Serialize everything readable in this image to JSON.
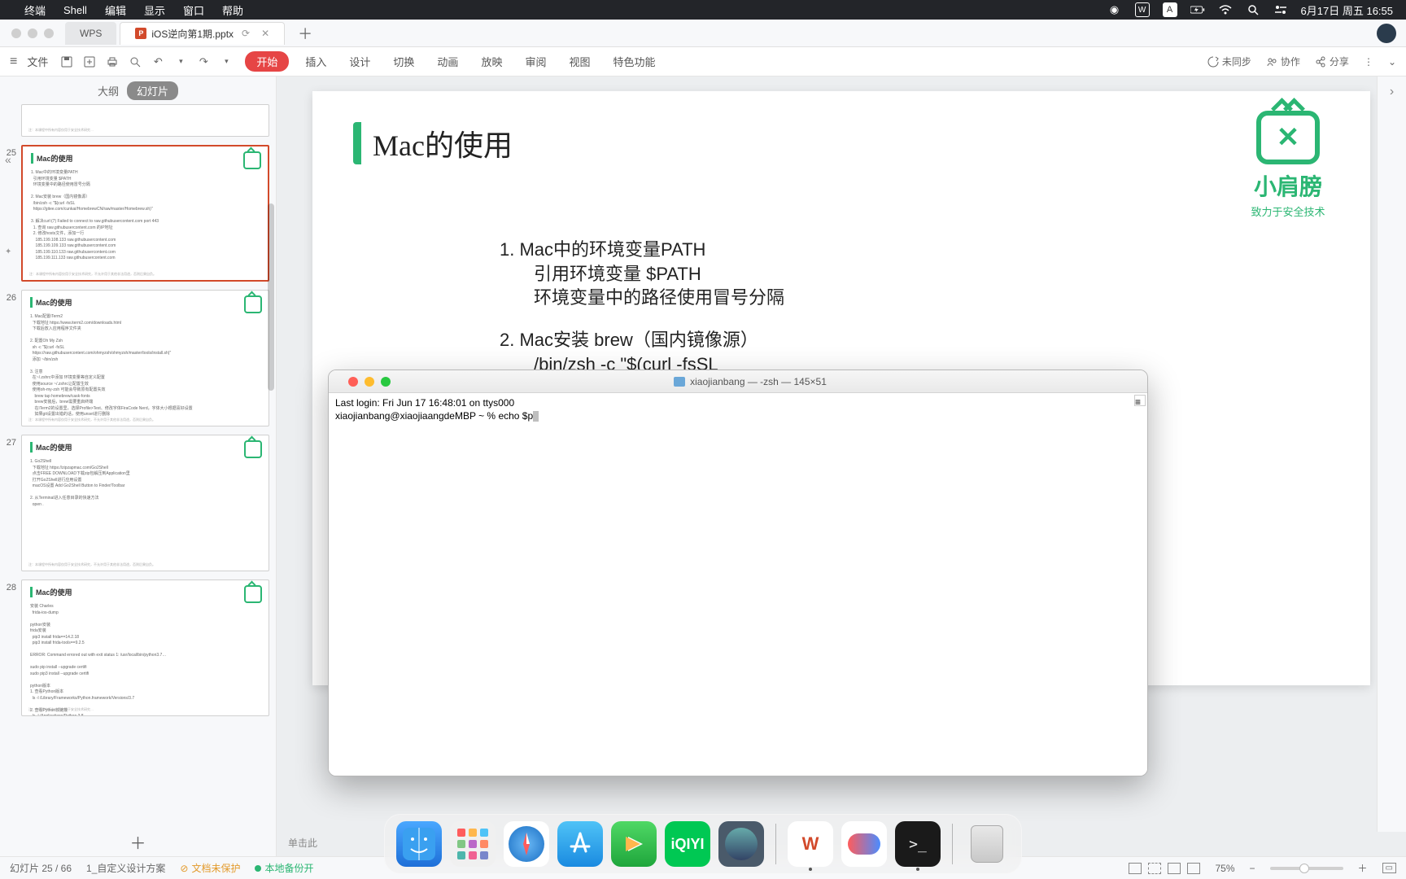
{
  "menubar": {
    "app": "终端",
    "items": [
      "Shell",
      "编辑",
      "显示",
      "窗口",
      "帮助"
    ],
    "date": "6月17日 周五 16:55"
  },
  "wps": {
    "home_tab": "WPS",
    "file_tab": "iOS逆向第1期.pptx",
    "ribbon": {
      "file": "文件",
      "start": "开始",
      "tabs": [
        "插入",
        "设计",
        "切换",
        "动画",
        "放映",
        "审阅",
        "视图",
        "特色功能"
      ],
      "unsync": "未同步",
      "collab": "协作",
      "share": "分享"
    },
    "left": {
      "outline": "大纲",
      "slides": "幻灯片",
      "thumb_title": "Mac的使用",
      "numbers": [
        "25",
        "26",
        "27",
        "28"
      ]
    },
    "slide": {
      "title": "Mac的使用",
      "l1": "1. Mac中的环境变量PATH",
      "l1a": "引用环境变量 $PATH",
      "l1b": "环境变量中的路径使用冒号分隔",
      "l2": "2. Mac安装 brew（国内镜像源）",
      "l2a": "/bin/zsh -c \"$(curl -fsSL",
      "right_snip": "地址",
      "foot": "注",
      "brand": "小肩膀",
      "tagline": "致力于安全技术"
    },
    "canvas_hint": "单击此",
    "status": {
      "page": "幻灯片 25 / 66",
      "scheme": "1_自定义设计方案",
      "protect": "文档未保护",
      "backup": "本地备份开",
      "zoom": "75%"
    }
  },
  "terminal": {
    "title": "xiaojianbang — -zsh — 145×51",
    "line1": "Last login: Fri Jun 17 16:48:01 on ttys000",
    "line2_prefix": "xiaojianbang@xiaojiaangdeMBP ~ % ",
    "command": "echo $p"
  }
}
